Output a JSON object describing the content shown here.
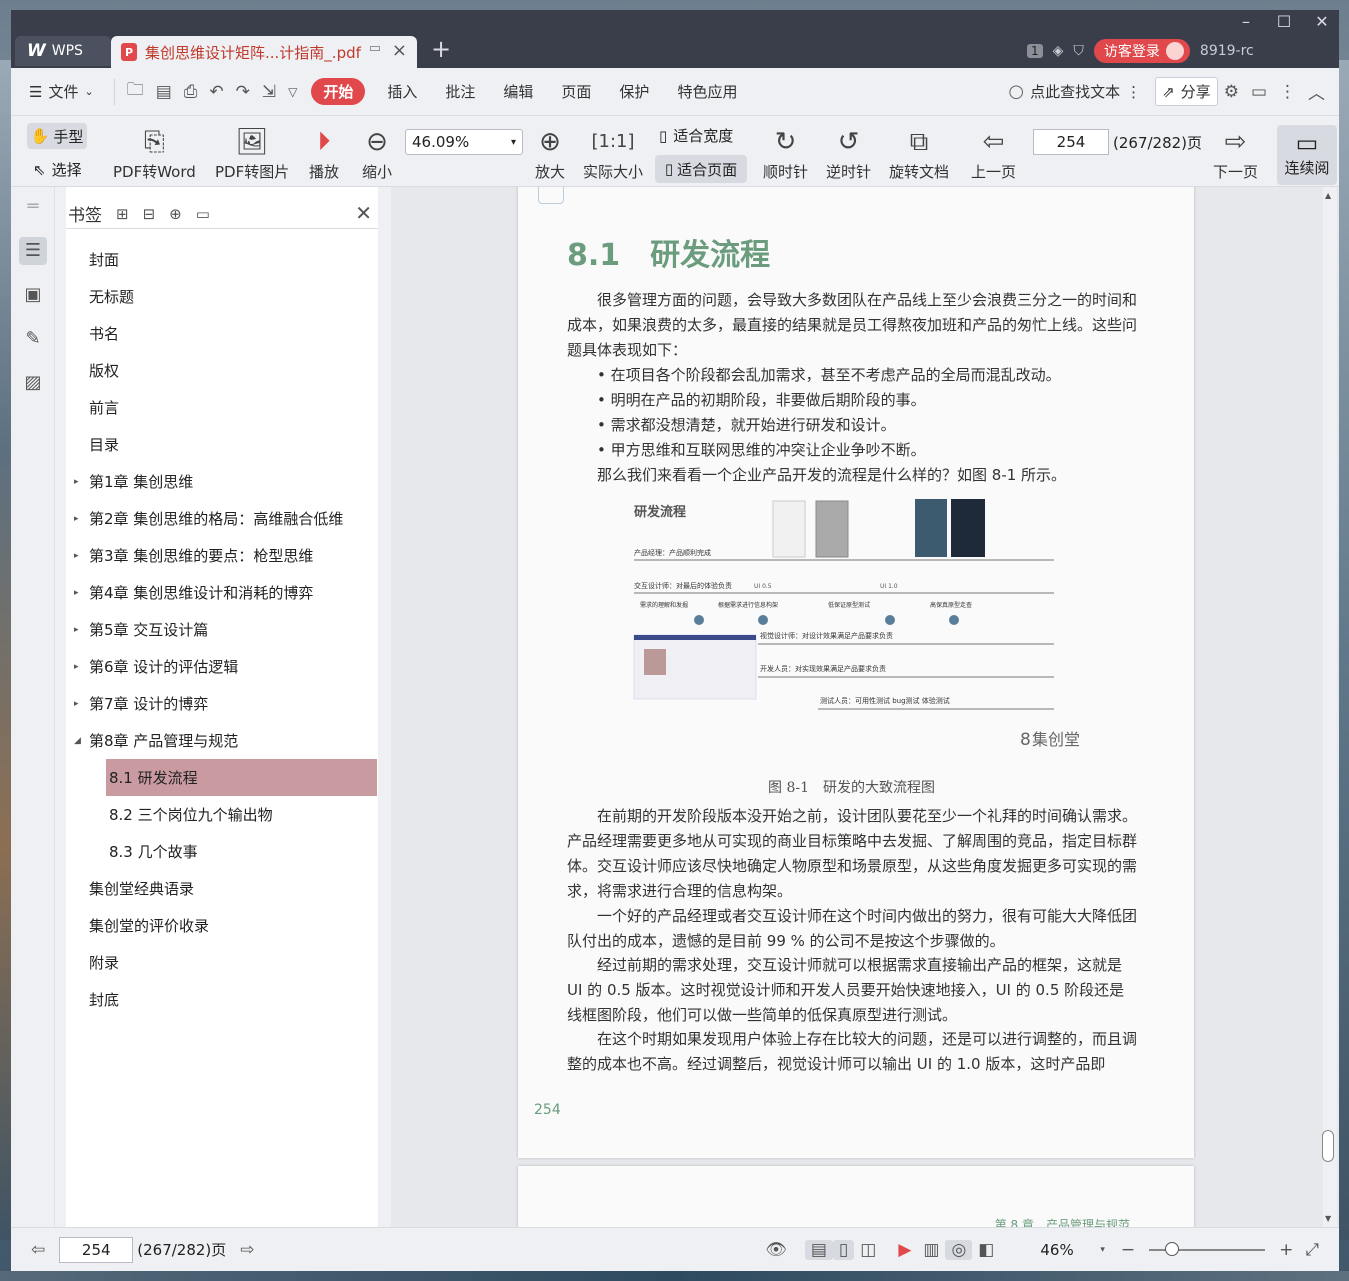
{
  "app": {
    "name": "WPS"
  },
  "tab": {
    "title": "集创思维设计矩阵...计指南_.pdf"
  },
  "titlebar": {
    "page_count_badge": "1",
    "login_label": "访客登录",
    "version_text": "8919-rc"
  },
  "menu": {
    "file_label": "文件",
    "items": [
      "开始",
      "插入",
      "批注",
      "编辑",
      "页面",
      "保护",
      "特色应用"
    ],
    "search_label": "点此查找文本",
    "share_label": "分享"
  },
  "toolbar": {
    "hand_label": "手型",
    "select_label": "选择",
    "pdf_to_word": "PDF转Word",
    "pdf_to_image": "PDF转图片",
    "play": "播放",
    "zoom_out": "缩小",
    "zoom_value": "46.09%",
    "zoom_in": "放大",
    "actual_size": "实际大小",
    "fit_width": "适合宽度",
    "fit_page": "适合页面",
    "clockwise": "顺时针",
    "counterclockwise": "逆时针",
    "rotate_doc": "旋转文档",
    "prev_page": "上一页",
    "page_input": "254",
    "page_total": "(267/282)页",
    "next_page": "下一页",
    "continuous_read": "连续阅"
  },
  "bookmarks": {
    "title": "书签",
    "items": [
      {
        "label": "封面",
        "level": 0
      },
      {
        "label": "无标题",
        "level": 0
      },
      {
        "label": "书名",
        "level": 0
      },
      {
        "label": "版权",
        "level": 0
      },
      {
        "label": "前言",
        "level": 0
      },
      {
        "label": "目录",
        "level": 0
      },
      {
        "label": "第1章 集创思维",
        "level": 0,
        "expandable": true
      },
      {
        "label": "第2章 集创思维的格局：高维融合低维",
        "level": 0,
        "expandable": true
      },
      {
        "label": "第3章 集创思维的要点：枪型思维",
        "level": 0,
        "expandable": true
      },
      {
        "label": "第4章 集创思维设计和消耗的博弈",
        "level": 0,
        "expandable": true
      },
      {
        "label": "第5章 交互设计篇",
        "level": 0,
        "expandable": true
      },
      {
        "label": "第6章 设计的评估逻辑",
        "level": 0,
        "expandable": true
      },
      {
        "label": "第7章 设计的博弈",
        "level": 0,
        "expandable": true
      },
      {
        "label": "第8章 产品管理与规范",
        "level": 0,
        "expanded": true
      },
      {
        "label": "8.1 研发流程",
        "level": 1,
        "selected": true
      },
      {
        "label": "8.2 三个岗位九个输出物",
        "level": 1
      },
      {
        "label": "8.3 几个故事",
        "level": 1
      },
      {
        "label": "集创堂经典语录",
        "level": 0
      },
      {
        "label": "集创堂的评价收录",
        "level": 0
      },
      {
        "label": "附录",
        "level": 0
      },
      {
        "label": "封底",
        "level": 0
      }
    ]
  },
  "document": {
    "heading": "8.1　研发流程",
    "p1": "很多管理方面的问题，会导致大多数团队在产品线上至少会浪费三分之一的时间和成本，如果浪费的太多，最直接的结果就是员工得熬夜加班和产品的匆忙上线。这些问题具体表现如下：",
    "bullets": [
      "• 在项目各个阶段都会乱加需求，甚至不考虑产品的全局而混乱改动。",
      "• 明明在产品的初期阶段，非要做后期阶段的事。",
      "• 需求都没想清楚，就开始进行研发和设计。",
      "• 甲方思维和互联网思维的冲突让企业争吵不断。"
    ],
    "p2": "那么我们来看看一个企业产品开发的流程是什么样的？如图 8-1 所示。",
    "figure": {
      "title": "研发流程",
      "rows": [
        "产品经理：产品顺利完成",
        "交互设计师：对最后的体验负责",
        "视觉设计师：对设计效果满足产品要求负责",
        "开发人员：对实现效果满足产品要求负责",
        "测试人员：可用性测试 bug测试 体验测试"
      ],
      "milestones": [
        "UI 0.5",
        "UI 1.0"
      ],
      "steps": [
        "需求的理解和发掘",
        "根据需求进行信息构架",
        "低保证原型测试",
        "高保真原型走查"
      ],
      "brand": "集创堂"
    },
    "caption": "图 8-1　研发的大致流程图",
    "p3": "在前期的开发阶段版本没开始之前，设计团队要花至少一个礼拜的时间确认需求。产品经理需要更多地从可实现的商业目标策略中去发掘、了解周围的竞品，指定目标群体。交互设计师应该尽快地确定人物原型和场景原型，从这些角度发掘更多可实现的需求，将需求进行合理的信息构架。",
    "p4": "一个好的产品经理或者交互设计师在这个时间内做出的努力，很有可能大大降低团队付出的成本，遗憾的是目前 99 % 的公司不是按这个步骤做的。",
    "p5": "经过前期的需求处理，交互设计师就可以根据需求直接输出产品的框架，这就是 UI 的 0.5 版本。这时视觉设计师和开发人员要开始快速地接入，UI 的 0.5 阶段还是线框图阶段，他们可以做一些简单的低保真原型进行测试。",
    "p6": "在这个时期如果发现用户体验上存在比较大的问题，还是可以进行调整的，而且调整的成本也不高。经过调整后，视觉设计师可以输出 UI 的 1.0 版本，这时产品即",
    "page_number": "254",
    "next_running_head": "第 8 章　产品管理与规范"
  },
  "statusbar": {
    "page_input": "254",
    "page_total": "(267/282)页",
    "zoom": "46%"
  },
  "colors": {
    "accent": "#e0484b",
    "heading_green": "#6b9c7e",
    "selected_bookmark": "#c99aa0"
  }
}
